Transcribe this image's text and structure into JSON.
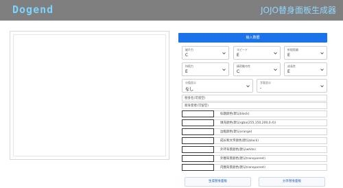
{
  "header": {
    "logo": "Dogend",
    "title": "JOJO替身面板生成器"
  },
  "form": {
    "header_button": "输入数据",
    "selects": [
      {
        "label": "破坏力",
        "value": "C"
      },
      {
        "label": "スピード",
        "value": "E"
      },
      {
        "label": "射程距離",
        "value": "E"
      },
      {
        "label": "持続力",
        "value": "E"
      },
      {
        "label": "精密動作性",
        "value": "C"
      },
      {
        "label": "成長性",
        "value": "E"
      },
      {
        "label": "分值显示",
        "value": "なし"
      },
      {
        "label": "字面显示",
        "value": "-"
      }
    ],
    "text_fields": [
      {
        "placeholder": "替身名(可留空)"
      },
      {
        "placeholder": "替身使者(可留空)"
      }
    ],
    "color_fields": [
      {
        "label": "标题颜色(默认black)"
      },
      {
        "label": "填充颜色(默认rgba(255,150,200,0.4))"
      },
      {
        "label": "边框颜色(默认orange)"
      },
      {
        "label": "成长和文字颜色(默认black)"
      },
      {
        "label": "外环背景颜色(默认white)"
      },
      {
        "label": "外圈背景颜色(默认transparent)"
      },
      {
        "label": "内圈背景颜色(默认transparent)"
      }
    ]
  },
  "buttons": {
    "generate": "生成替身面板",
    "share": "分享替身面板"
  },
  "colors": {
    "topbar": "#7f7f7f",
    "accent": "#1a73e8",
    "logo": "#7dd3fc"
  }
}
